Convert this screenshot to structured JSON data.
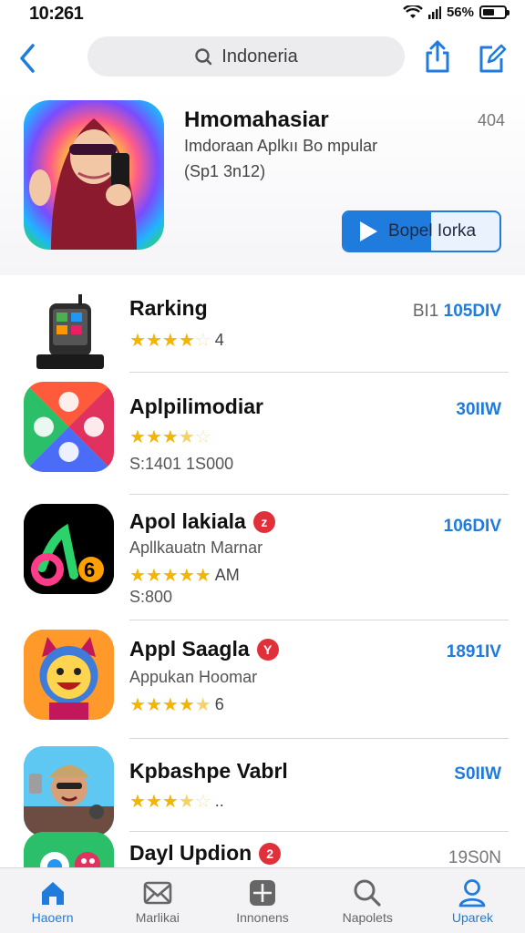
{
  "status": {
    "time": "10:261",
    "battery": "56%",
    "battery_level": 0.56
  },
  "nav": {
    "search_text": "Indoneria"
  },
  "hero": {
    "title": "Hmomahasiar",
    "subtitle": "Imdoraan Aplkıı Bo mpular",
    "meta": "(Sp1 3n12)",
    "count": "404",
    "button_label": "Bopel Iorka"
  },
  "apps": [
    {
      "title": "Rarking",
      "subtitle": "",
      "stars": 4,
      "stars_extra": "4",
      "meta": "",
      "price_grey": "BI1",
      "price": "105DIV",
      "badge": ""
    },
    {
      "title": "Aplpilimodiar",
      "subtitle": "",
      "stars": 3.5,
      "stars_extra": "",
      "meta": "S:1401 1S000",
      "price_grey": "",
      "price": "30IIW",
      "badge": ""
    },
    {
      "title": "Apol lakiala",
      "subtitle": "Apllkauatn Marnar",
      "stars": 5,
      "stars_extra": "AM",
      "meta": "S:800",
      "price_grey": "",
      "price": "106DIV",
      "badge": "z"
    },
    {
      "title": "Appl Saagla",
      "subtitle": "Appukan Hoomar",
      "stars": 4.5,
      "stars_extra": "6",
      "meta": "",
      "price_grey": "",
      "price": "1891IV",
      "badge": "Y"
    },
    {
      "title": "Kpbashpe Vabrl",
      "subtitle": "",
      "stars": 3.5,
      "stars_extra": "..",
      "meta": "",
      "price_grey": "",
      "price": "S0IIW",
      "badge": ""
    },
    {
      "title": "Dayl Updion",
      "subtitle": "",
      "stars": 0,
      "stars_extra": "",
      "meta": "",
      "price_grey": "",
      "price": "19S0N",
      "badge": "2"
    }
  ],
  "tabs": [
    {
      "label": "Haoern",
      "icon": "home-icon",
      "active": true
    },
    {
      "label": "Marlikai",
      "icon": "mail-icon",
      "active": false
    },
    {
      "label": "Innonens",
      "icon": "grid-icon",
      "active": false
    },
    {
      "label": "Napolets",
      "icon": "search-icon",
      "active": false
    },
    {
      "label": "Uparek",
      "icon": "person-icon",
      "active": true
    }
  ],
  "colors": {
    "accent": "#1f7bdc",
    "badge": "#e0313a",
    "star": "#f4b400"
  }
}
